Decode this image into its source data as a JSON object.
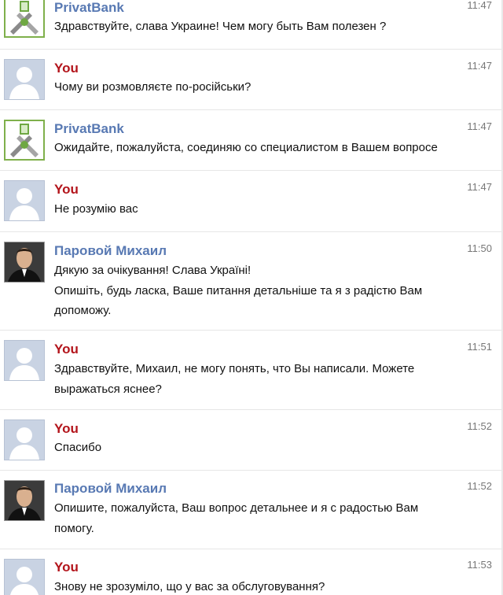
{
  "messages": [
    {
      "sender": "PrivatBank",
      "kind": "bank",
      "time": "11:47",
      "avatar": "privatbank-logo",
      "lines": [
        "Здравствуйте, слава Украине! Чем могу быть Вам полезен ?"
      ]
    },
    {
      "sender": "You",
      "kind": "you",
      "time": "11:47",
      "avatar": "default-user",
      "lines": [
        "Чому ви розмовляєте по-російськи?"
      ]
    },
    {
      "sender": "PrivatBank",
      "kind": "bank",
      "time": "11:47",
      "avatar": "privatbank-logo",
      "lines": [
        "Ожидайте, пожалуйста, соединяю со специалистом в Вашем вопросе"
      ]
    },
    {
      "sender": "You",
      "kind": "you",
      "time": "11:47",
      "avatar": "default-user",
      "lines": [
        "Не розумію вас"
      ]
    },
    {
      "sender": "Паровой Михаил",
      "kind": "agent",
      "time": "11:50",
      "avatar": "agent-photo",
      "lines": [
        "Дякую за очікування! Слава Україні!",
        "Опишіть, будь ласка, Ваше питання детальніше та я з радістю Вам",
        "допоможу."
      ]
    },
    {
      "sender": "You",
      "kind": "you",
      "time": "11:51",
      "avatar": "default-user",
      "lines": [
        "Здравствуйте, Михаил, не могу понять, что Вы написали. Можете",
        "выражаться яснее?"
      ]
    },
    {
      "sender": "You",
      "kind": "you",
      "time": "11:52",
      "avatar": "default-user",
      "lines": [
        "Спасибо"
      ]
    },
    {
      "sender": "Паровой Михаил",
      "kind": "agent",
      "time": "11:52",
      "avatar": "agent-photo",
      "lines": [
        "Опишите, пожалуйста, Ваш вопрос детальнее и я с радостью Вам",
        "помогу."
      ]
    },
    {
      "sender": "You",
      "kind": "you",
      "time": "11:53",
      "avatar": "default-user",
      "lines": [
        "Знову не зрозуміло, що у вас за обслуговування?"
      ]
    }
  ],
  "colors": {
    "bank_name": "#5879b3",
    "you_name": "#b3141b",
    "agent_name": "#5879b3",
    "divider": "#e6e6e6"
  }
}
